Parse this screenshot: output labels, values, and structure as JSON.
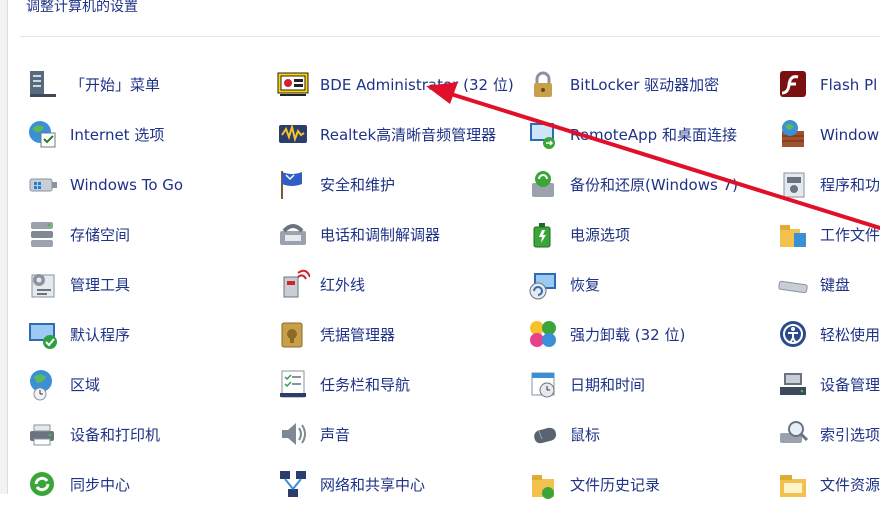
{
  "page": {
    "title": "调整计算机的设置"
  },
  "columns": [
    [
      {
        "label": "「开始」菜单",
        "icon": "start-menu-icon"
      },
      {
        "label": "Internet 选项",
        "icon": "internet-options-icon"
      },
      {
        "label": "Windows To Go",
        "icon": "windows-to-go-icon"
      },
      {
        "label": "存储空间",
        "icon": "storage-spaces-icon"
      },
      {
        "label": "管理工具",
        "icon": "admin-tools-icon"
      },
      {
        "label": "默认程序",
        "icon": "default-programs-icon"
      },
      {
        "label": "区域",
        "icon": "region-icon"
      },
      {
        "label": "设备和打印机",
        "icon": "devices-printers-icon"
      },
      {
        "label": "同步中心",
        "icon": "sync-center-icon"
      }
    ],
    [
      {
        "label": "BDE Administrator (32 位)",
        "icon": "bde-administrator-icon"
      },
      {
        "label": "Realtek高清晰音频管理器",
        "icon": "realtek-audio-icon"
      },
      {
        "label": "安全和维护",
        "icon": "security-maintenance-icon"
      },
      {
        "label": "电话和调制解调器",
        "icon": "phone-modem-icon"
      },
      {
        "label": "红外线",
        "icon": "infrared-icon"
      },
      {
        "label": "凭据管理器",
        "icon": "credential-manager-icon"
      },
      {
        "label": "任务栏和导航",
        "icon": "taskbar-navigation-icon"
      },
      {
        "label": "声音",
        "icon": "sound-icon"
      },
      {
        "label": "网络和共享中心",
        "icon": "network-sharing-icon"
      }
    ],
    [
      {
        "label": "BitLocker 驱动器加密",
        "icon": "bitlocker-icon"
      },
      {
        "label": "RemoteApp 和桌面连接",
        "icon": "remoteapp-icon"
      },
      {
        "label": "备份和还原(Windows 7)",
        "icon": "backup-restore-icon"
      },
      {
        "label": "电源选项",
        "icon": "power-options-icon"
      },
      {
        "label": "恢复",
        "icon": "recovery-icon"
      },
      {
        "label": "强力卸载 (32 位)",
        "icon": "force-uninstall-icon"
      },
      {
        "label": "日期和时间",
        "icon": "date-time-icon"
      },
      {
        "label": "鼠标",
        "icon": "mouse-icon"
      },
      {
        "label": "文件历史记录",
        "icon": "file-history-icon"
      }
    ],
    [
      {
        "label": "Flash Pl",
        "icon": "flash-player-icon"
      },
      {
        "label": "Window 墙",
        "icon": "windows-firewall-icon"
      },
      {
        "label": "程序和功",
        "icon": "programs-features-icon"
      },
      {
        "label": "工作文件",
        "icon": "work-folders-icon"
      },
      {
        "label": "键盘",
        "icon": "keyboard-icon"
      },
      {
        "label": "轻松使用",
        "icon": "ease-of-access-icon"
      },
      {
        "label": "设备管理",
        "icon": "device-manager-icon"
      },
      {
        "label": "索引选项",
        "icon": "indexing-options-icon"
      },
      {
        "label": "文件资源",
        "icon": "file-explorer-icon"
      }
    ]
  ],
  "colors": {
    "link": "#1e3287",
    "annotation_arrow": "#e0102a"
  }
}
